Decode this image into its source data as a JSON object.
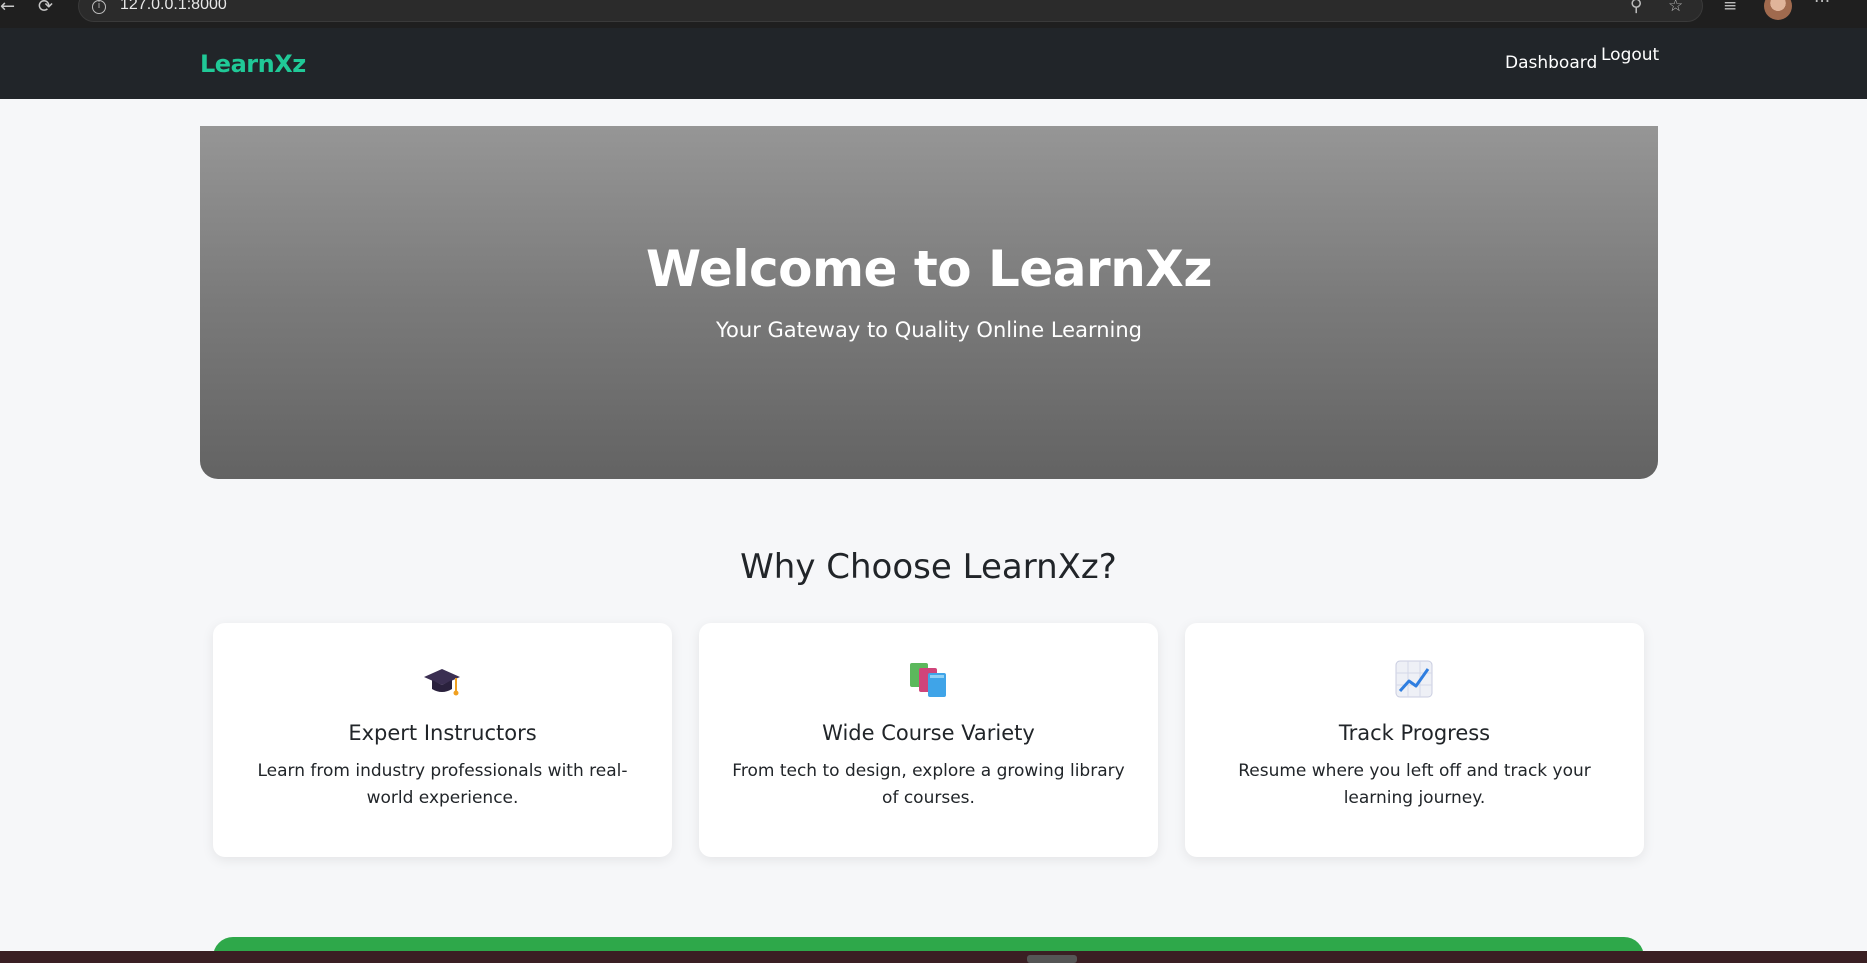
{
  "browser": {
    "url": "127.0.0.1:8000",
    "icons": [
      "back-arrow-icon",
      "reload-icon",
      "info-icon",
      "zoom-icon",
      "star-icon",
      "favorites-icon",
      "profile-avatar",
      "more-icon"
    ]
  },
  "navbar": {
    "brand": "LearnXz",
    "links": {
      "dashboard": "Dashboard",
      "logout": "Logout"
    },
    "colors": {
      "background": "#212529",
      "brand": "#20c997"
    }
  },
  "hero": {
    "title": "Welcome to LearnXz",
    "subtitle": "Your Gateway to Quality Online Learning"
  },
  "features": {
    "heading": "Why Choose LearnXz?",
    "cards": [
      {
        "icon": "graduation-cap-icon",
        "title": "Expert Instructors",
        "text": "Learn from industry professionals with real-world experience."
      },
      {
        "icon": "books-icon",
        "title": "Wide Course Variety",
        "text": "From tech to design, explore a growing library of courses."
      },
      {
        "icon": "chart-increasing-icon",
        "title": "Track Progress",
        "text": "Resume where you left off and track your learning journey."
      }
    ]
  },
  "cta": {
    "color": "#2ea84a"
  }
}
